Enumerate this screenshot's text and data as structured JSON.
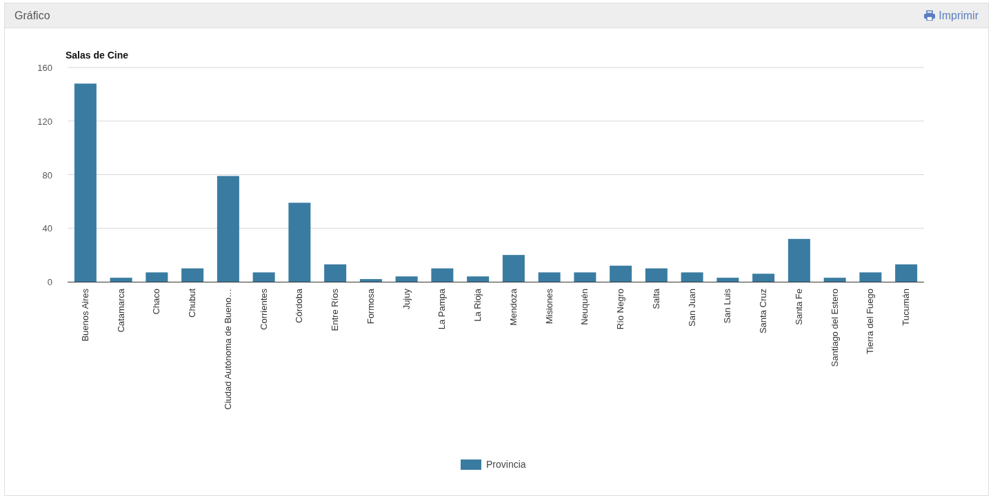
{
  "panel": {
    "title": "Gráfico",
    "print_link": "Imprimir"
  },
  "chart": {
    "chart_data": {
      "type": "bar",
      "title": "Salas de Cine",
      "categories": [
        "Buenos Aires",
        "Catamarca",
        "Chaco",
        "Chubut",
        "Ciudad Autónoma de Bueno…",
        "Corrientes",
        "Córdoba",
        "Entre Ríos",
        "Formosa",
        "Jujuy",
        "La Pampa",
        "La Rioja",
        "Mendoza",
        "Misiones",
        "Neuquén",
        "Río Negro",
        "Salta",
        "San Juan",
        "San Luis",
        "Santa Cruz",
        "Santa Fe",
        "Santiago del Estero",
        "Tierra del Fuego",
        "Tucumán"
      ],
      "series": [
        {
          "name": "Provincia",
          "color": "#3a7ca1",
          "values": [
            148,
            3,
            7,
            10,
            79,
            7,
            59,
            13,
            2,
            4,
            10,
            4,
            20,
            7,
            7,
            12,
            10,
            7,
            3,
            6,
            32,
            3,
            7,
            13
          ]
        }
      ],
      "ylim": [
        0,
        160
      ],
      "grid": true,
      "yticks": [
        0,
        40,
        80,
        120,
        160
      ]
    }
  }
}
